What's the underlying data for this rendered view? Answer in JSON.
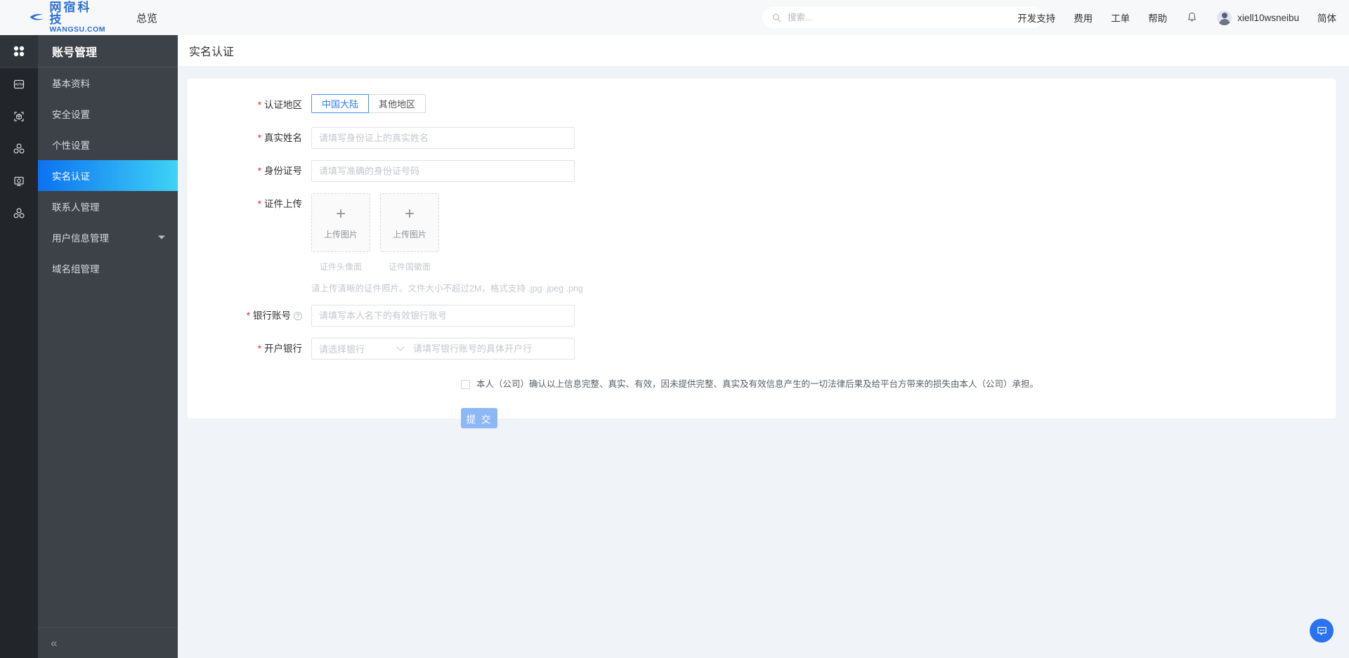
{
  "header": {
    "logo_top": "网宿科技",
    "logo_bottom": "WANGSU.COM",
    "nav_overview": "总览",
    "search_placeholder": "搜索...",
    "search_value": "",
    "links": [
      "开发支持",
      "费用",
      "工单",
      "帮助"
    ],
    "user_name": "xiell10wsneibu",
    "language": "简体"
  },
  "rail": {
    "items": [
      {
        "name": "apps-grid-icon"
      },
      {
        "name": "apm-icon"
      },
      {
        "name": "cube-frame-icon"
      },
      {
        "name": "cubes-icon"
      },
      {
        "name": "server-monitor-icon"
      },
      {
        "name": "cubes-alt-icon"
      }
    ]
  },
  "sidebar": {
    "title": "账号管理",
    "items": [
      {
        "label": "基本资料",
        "active": false,
        "caret": false
      },
      {
        "label": "安全设置",
        "active": false,
        "caret": false
      },
      {
        "label": "个性设置",
        "active": false,
        "caret": false
      },
      {
        "label": "实名认证",
        "active": true,
        "caret": false
      },
      {
        "label": "联系人管理",
        "active": false,
        "caret": false
      },
      {
        "label": "用户信息管理",
        "active": false,
        "caret": true
      },
      {
        "label": "域名组管理",
        "active": false,
        "caret": false
      }
    ],
    "collapse_icon": "«"
  },
  "page": {
    "title": "实名认证"
  },
  "form": {
    "region": {
      "label": "认证地区",
      "options": [
        "中国大陆",
        "其他地区"
      ],
      "selected": "中国大陆"
    },
    "real_name": {
      "label": "真实姓名",
      "placeholder": "请填写身份证上的真实姓名",
      "value": ""
    },
    "id_number": {
      "label": "身份证号",
      "placeholder": "请填写准确的身份证号码",
      "value": ""
    },
    "upload": {
      "label": "证件上传",
      "boxes": [
        {
          "button_text": "上传图片",
          "caption": "证件头像面"
        },
        {
          "button_text": "上传图片",
          "caption": "证件国徽面"
        }
      ],
      "hint": "请上传清晰的证件照片。文件大小不超过2M，格式支持 .jpg .jpeg .png"
    },
    "bank_account": {
      "label": "银行账号",
      "placeholder": "请填写本人名下的有效银行账号",
      "value": "",
      "help_icon": "?"
    },
    "bank_branch": {
      "label": "开户银行",
      "select_placeholder": "请选择银行",
      "input_placeholder": "请填写银行账号的具体开户行",
      "value": ""
    },
    "agreement": {
      "checked": false,
      "text": "本人（公司）确认以上信息完整、真实、有效，因未提供完整、真实及有效信息产生的一切法律后果及给平台方带来的损失由本人（公司）承担。"
    },
    "submit_label": "提 交"
  },
  "chat": {
    "icon": "chat-bubble-icon"
  },
  "colors": {
    "brand_blue": "#2b6fd6",
    "accent_blue": "#2a72f0",
    "active_gradient_start": "#0b72f0",
    "active_gradient_end": "#3fd3f5",
    "required_red": "#f5222d",
    "submit_blue": "#8cb8f5"
  }
}
